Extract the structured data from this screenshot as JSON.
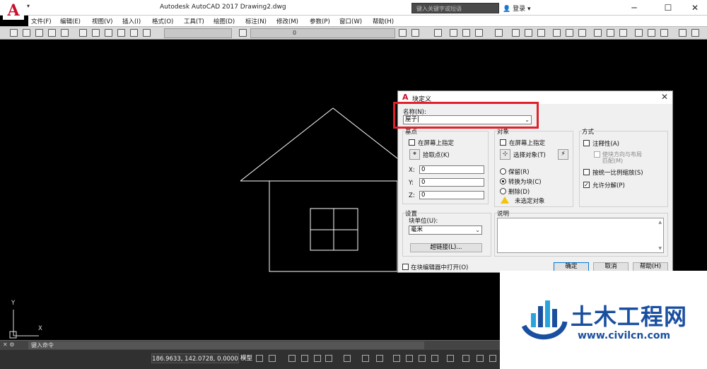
{
  "titlebar": {
    "logo": "A",
    "title": "Autodesk AutoCAD 2017    Drawing2.dwg",
    "search_placeholder": "键入关键字或短语",
    "login": "登录",
    "minimize": "─",
    "maximize": "☐",
    "close": "✕"
  },
  "menu": [
    "文件(F)",
    "编辑(E)",
    "视图(V)",
    "插入(I)",
    "格式(O)",
    "工具(T)",
    "绘图(D)",
    "标注(N)",
    "修改(M)",
    "参数(P)",
    "窗口(W)",
    "帮助(H)"
  ],
  "toolbar": {
    "layer_value": "0"
  },
  "dialog": {
    "title": "块定义",
    "close": "✕",
    "name_label": "名称(N):",
    "name_value": "屋子|",
    "base_group": "基点",
    "base_on_screen": "在屏幕上指定",
    "pick_point": "拾取点(K)",
    "x_label": "X:",
    "x_value": "0",
    "y_label": "Y:",
    "y_value": "0",
    "z_label": "Z:",
    "z_value": "0",
    "object_group": "对象",
    "obj_on_screen": "在屏幕上指定",
    "select_objects": "选择对象(T)",
    "retain": "保留(R)",
    "convert": "转换为块(C)",
    "delete": "删除(D)",
    "none_selected": "未选定对象",
    "behavior_group": "方式",
    "annotative": "注释性(A)",
    "match_orient": "使块方向与布局",
    "match_orient_2": "匹配(M)",
    "uniform_scale": "按统一比例缩放(S)",
    "allow_explode": "允许分解(P)",
    "settings_group": "设置",
    "block_unit_label": "块单位(U):",
    "block_unit_value": "毫米",
    "hyperlink": "超链接(L)...",
    "description_group": "说明",
    "open_in_editor": "在块编辑器中打开(O)",
    "ok": "确定",
    "cancel": "取消",
    "help": "帮助(H)"
  },
  "canvas": {
    "ucs_y": "Y",
    "ucs_x": "X"
  },
  "cmdline": {
    "prompt": "键入命令"
  },
  "status": {
    "coords": "186.9633, 142.0728, 0.0000",
    "model": "模型"
  },
  "watermark": {
    "name": "土木工程网",
    "url": "www.civilcn.com"
  }
}
